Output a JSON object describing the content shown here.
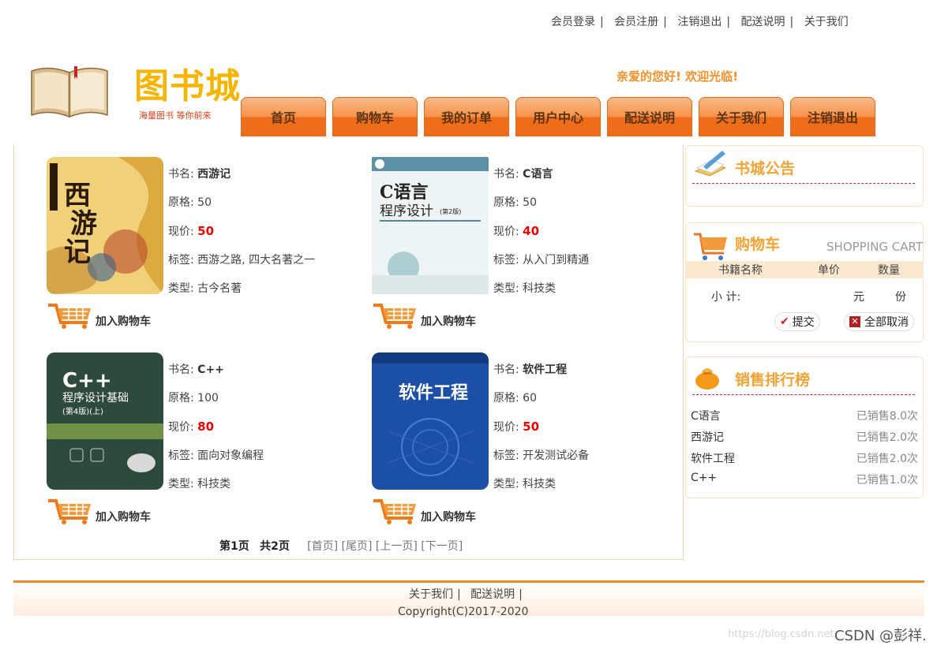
{
  "top_links": [
    "会员登录",
    "会员注册",
    "注销退出",
    "配送说明",
    "关于我们"
  ],
  "logo": {
    "title": "图书城",
    "subtitle": "海量图书 等你前来"
  },
  "welcome": "亲爱的您好! 欢迎光临!",
  "nav": [
    "首页",
    "购物车",
    "我的订单",
    "用户中心",
    "配送说明",
    "关于我们",
    "注销退出"
  ],
  "labels": {
    "name": "书名: ",
    "orig": "原格: ",
    "now": "现价: ",
    "tag": "标签: ",
    "type": "类型: ",
    "add_cart": "加入购物车"
  },
  "books": [
    {
      "name": "西游记",
      "orig": "50",
      "now": "50",
      "tag": "西游之路, 四大名著之一",
      "type": "古今名著",
      "cover_text": "西游记"
    },
    {
      "name": "C语言",
      "orig": "50",
      "now": "40",
      "tag": "从入门到精通",
      "type": "科技类",
      "cover_text": "C语言\n程序设计 (第2版)"
    },
    {
      "name": "C++",
      "orig": "100",
      "now": "80",
      "tag": "面向对象编程",
      "type": "科技类",
      "cover_text": "C++\n程序设计基础\n(第4版)(上)"
    },
    {
      "name": "软件工程",
      "orig": "60",
      "now": "50",
      "tag": "开发测试必备",
      "type": "科技类",
      "cover_text": "软件工程"
    }
  ],
  "pager": {
    "current": "第1页",
    "total": "共2页",
    "first": "[首页]",
    "last": "[尾页]",
    "prev": "[上一页]",
    "next": "[下一页]"
  },
  "notice": {
    "title": "书城公告"
  },
  "cart": {
    "title": "购物车",
    "title_en": "SHOPPING CART",
    "col_name": "书籍名称",
    "col_price": "单价",
    "col_qty": "数量",
    "subtotal_label": "小 计:",
    "unit_yuan": "元",
    "unit_fen": "份",
    "submit": "提交",
    "cancel_all": "全部取消"
  },
  "ranking": {
    "title": "销售排行榜",
    "items": [
      {
        "name": "C语言",
        "sold": "已销售8.0次"
      },
      {
        "name": "西游记",
        "sold": "已销售2.0次"
      },
      {
        "name": "软件工程",
        "sold": "已销售2.0次"
      },
      {
        "name": "C++",
        "sold": "已销售1.0次"
      }
    ]
  },
  "footer": {
    "links": [
      "关于我们",
      "配送说明"
    ],
    "copyright": "Copyright(C)2017-2020"
  },
  "watermark": {
    "url": "https://blog.csdn.net",
    "author": "CSDN @彭祥."
  },
  "colors": {
    "accent": "#ee6c1a",
    "gold": "#f7b500",
    "price_red": "#e00000",
    "rank_title": "#f4a334"
  }
}
